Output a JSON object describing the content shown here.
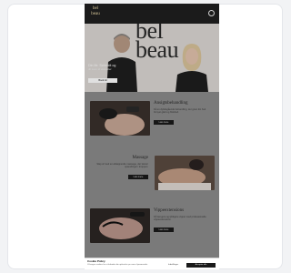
{
  "header": {
    "logo_line1": "bel",
    "logo_line2": "beau",
    "menu_icon": "menu-icon"
  },
  "hero": {
    "big_word_line1": "bel",
    "big_word_line2": "beau",
    "title": "Din Mr. Schmidt og",
    "subtitle": "dit team af eksperter",
    "button": "Book tid"
  },
  "services": [
    {
      "title": "Ansigtsbehandling",
      "desc": "Få en dybdegående behandling, der giver din hud fornyet glød og friskhed.",
      "button": "Læs mere"
    },
    {
      "title": "Massage",
      "desc": "Slap af med en afslappende massage, der løsner spændinger i kroppen.",
      "button": "Læs mere"
    },
    {
      "title": "Vippeextensions",
      "desc": "Få længere og fyldigere vipper med professionelle vippeextensions.",
      "button": "Læs mere"
    }
  ],
  "cookie": {
    "title": "Cookie Policy",
    "text": "Vi bruger cookies for at forbedre din oplevelse på vores hjemmeside.",
    "settings": "Indstillinger",
    "accept": "Accepter alle"
  },
  "colors": {
    "nav_bg": "#1b1b1b",
    "accent_gold": "#d8c89a",
    "content_bg": "#8b8b8b",
    "button_dark": "#1a1a1a"
  }
}
